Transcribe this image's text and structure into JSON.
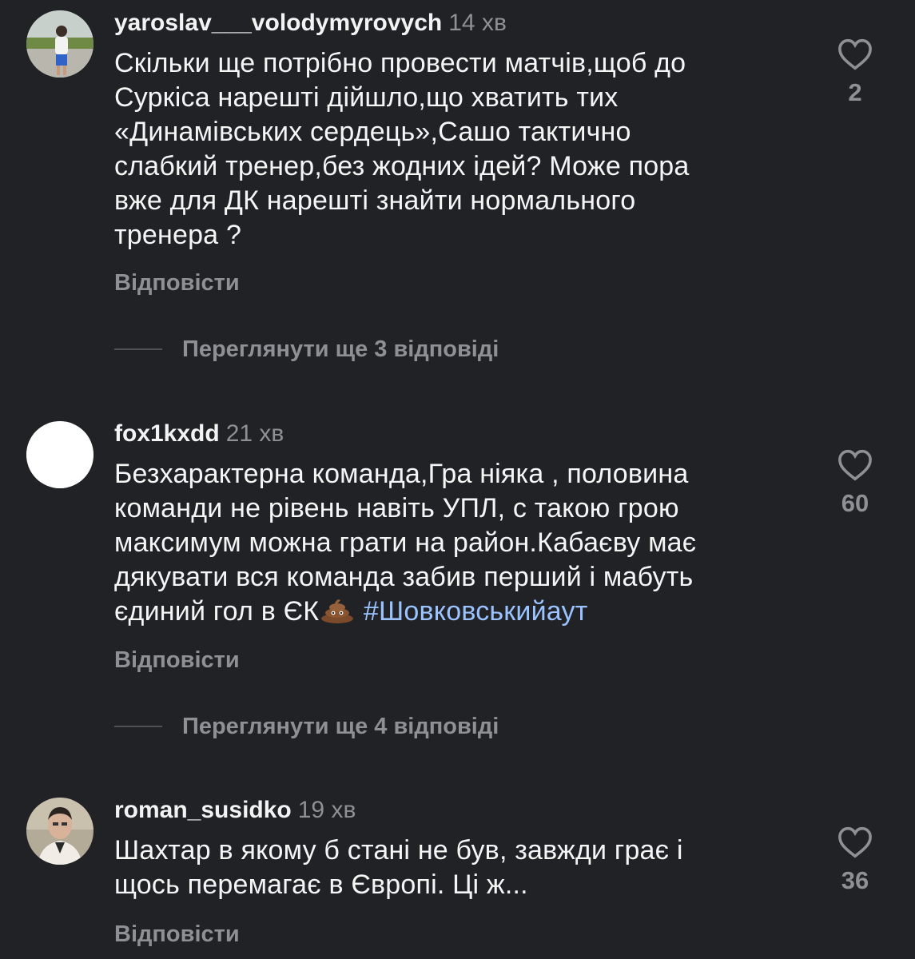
{
  "comments": [
    {
      "username": "yaroslav___volodymyrovych",
      "time": "14 хв",
      "lines": [
        "Скільки ще потрібно провести матчів,щоб до",
        "Суркіса нарешті дійшло,що хватить тих",
        "«Динамівських сердець»,Сашо тактично",
        "слабкий тренер,без жодних ідей? Може пора",
        "вже для ДК нарешті знайти нормального",
        "тренера ?"
      ],
      "like_count": "2",
      "reply_label": "Відповісти",
      "view_replies_label": "Переглянути ще 3 відповіді",
      "avatar": "photo-person-icon"
    },
    {
      "username": "fox1kxdd",
      "time": "21 хв",
      "lines": [
        "Безхарактерна команда,Гра ніяка , половина",
        "команди не рівень навіть УПЛ, с такою грою",
        "максимум можна грати на район.Кабаєву має",
        "дякувати вся команда  забив перший і мабуть"
      ],
      "last_line_text": "єдиний гол в ЄК",
      "emoji": "pile-of-poo-emoji",
      "hashtag": "#Шовковськийаут",
      "like_count": "60",
      "reply_label": "Відповісти",
      "view_replies_label": "Переглянути ще 4 відповіді",
      "avatar": "blank-white-avatar"
    },
    {
      "username": "roman_susidko",
      "time": "19 хв",
      "lines": [
        "Шахтар в якому б стані не був, завжди грає і",
        "щось перемагає в Європі. Ці ж..."
      ],
      "like_count": "36",
      "reply_label": "Відповісти",
      "avatar": "photo-portrait-icon"
    }
  ],
  "colors": {
    "background": "#202226",
    "text": "#f5f5f5",
    "muted": "#8e9096",
    "hashtag": "#9bc3ff"
  }
}
